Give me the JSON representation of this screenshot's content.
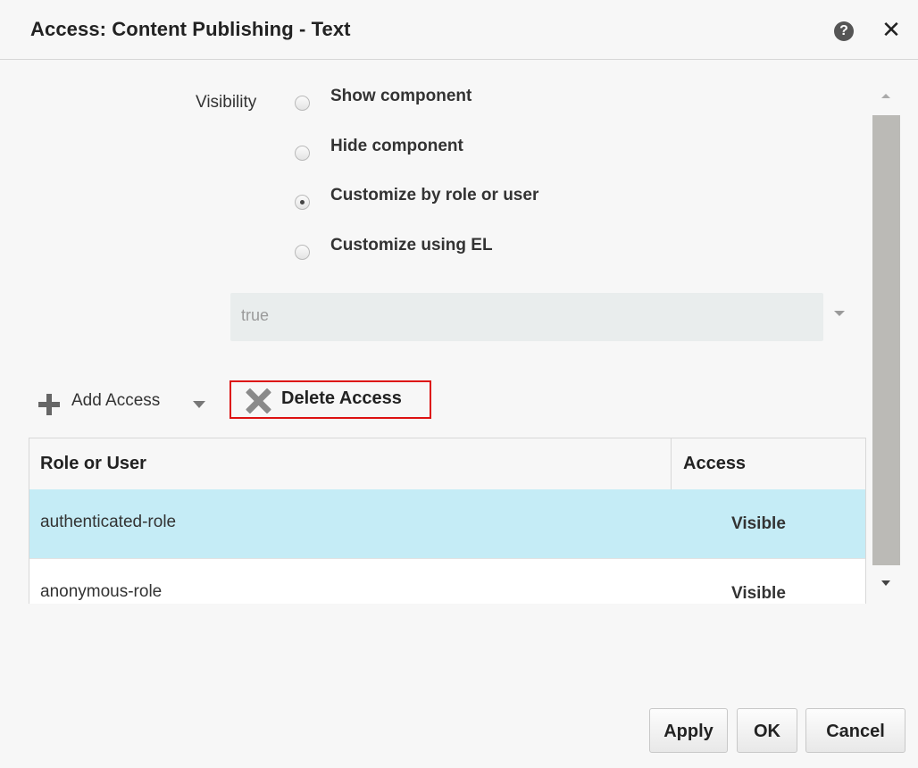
{
  "dialog": {
    "title": "Access: Content Publishing - Text",
    "help_icon": "question-circle-icon",
    "help_glyph": "?",
    "close_icon": "close-icon",
    "close_glyph": "✕"
  },
  "visibility": {
    "label": "Visibility",
    "options": [
      {
        "label": "Show component",
        "checked": false
      },
      {
        "label": "Hide component",
        "checked": false
      },
      {
        "label": "Customize by role or user",
        "checked": true
      },
      {
        "label": "Customize using EL",
        "checked": false
      }
    ],
    "el_value": "true"
  },
  "toolbar": {
    "add_label": "Add Access",
    "delete_label": "Delete Access"
  },
  "table": {
    "columns": [
      "Role or User",
      "Access"
    ],
    "rows": [
      {
        "role": "authenticated-role",
        "access": "Visible",
        "selected": true
      },
      {
        "role": "anonymous-role",
        "access": "Visible",
        "selected": false
      }
    ]
  },
  "buttons": {
    "apply": "Apply",
    "ok": "OK",
    "cancel": "Cancel"
  },
  "colors": {
    "selected_row": "#c5ecf6",
    "highlight_border": "#dd1111"
  }
}
